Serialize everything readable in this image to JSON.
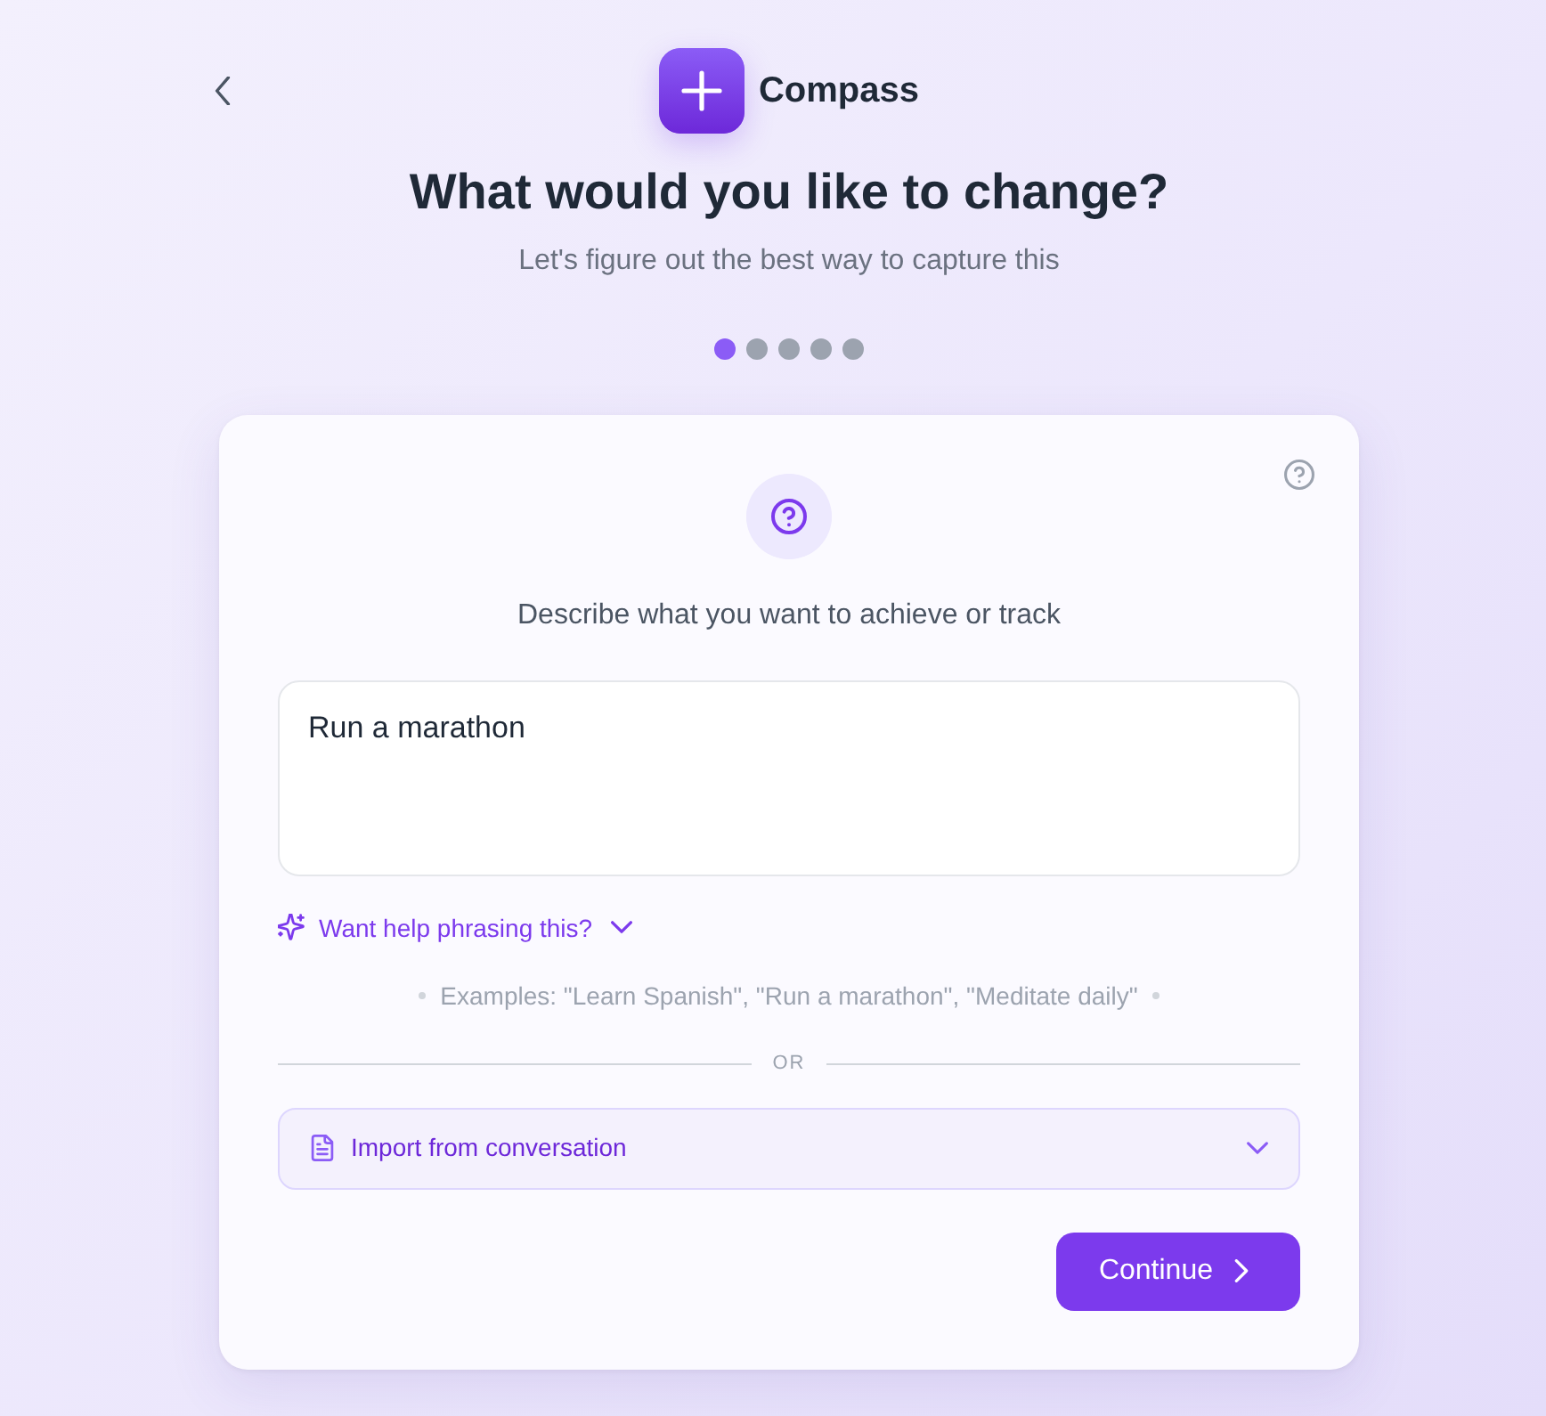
{
  "header": {
    "app_name": "Compass"
  },
  "title": "What would you like to change?",
  "subtitle": "Let's figure out the best way to capture this",
  "steps": [
    {
      "selected": true
    },
    {
      "selected": false
    },
    {
      "selected": false
    },
    {
      "selected": false
    },
    {
      "selected": false
    }
  ],
  "card": {
    "prompt": "Describe what you want to achieve or track",
    "answer": {
      "value": "Run a marathon"
    },
    "help_link": {
      "label": "Want help phrasing this?",
      "expanded": false
    },
    "examples": "Examples: \"Learn Spanish\", \"Run a marathon\", \"Meditate daily\"",
    "divider": "OR",
    "import": {
      "label": "Import from conversation",
      "expanded": false
    },
    "continue_button": "Continue"
  }
}
